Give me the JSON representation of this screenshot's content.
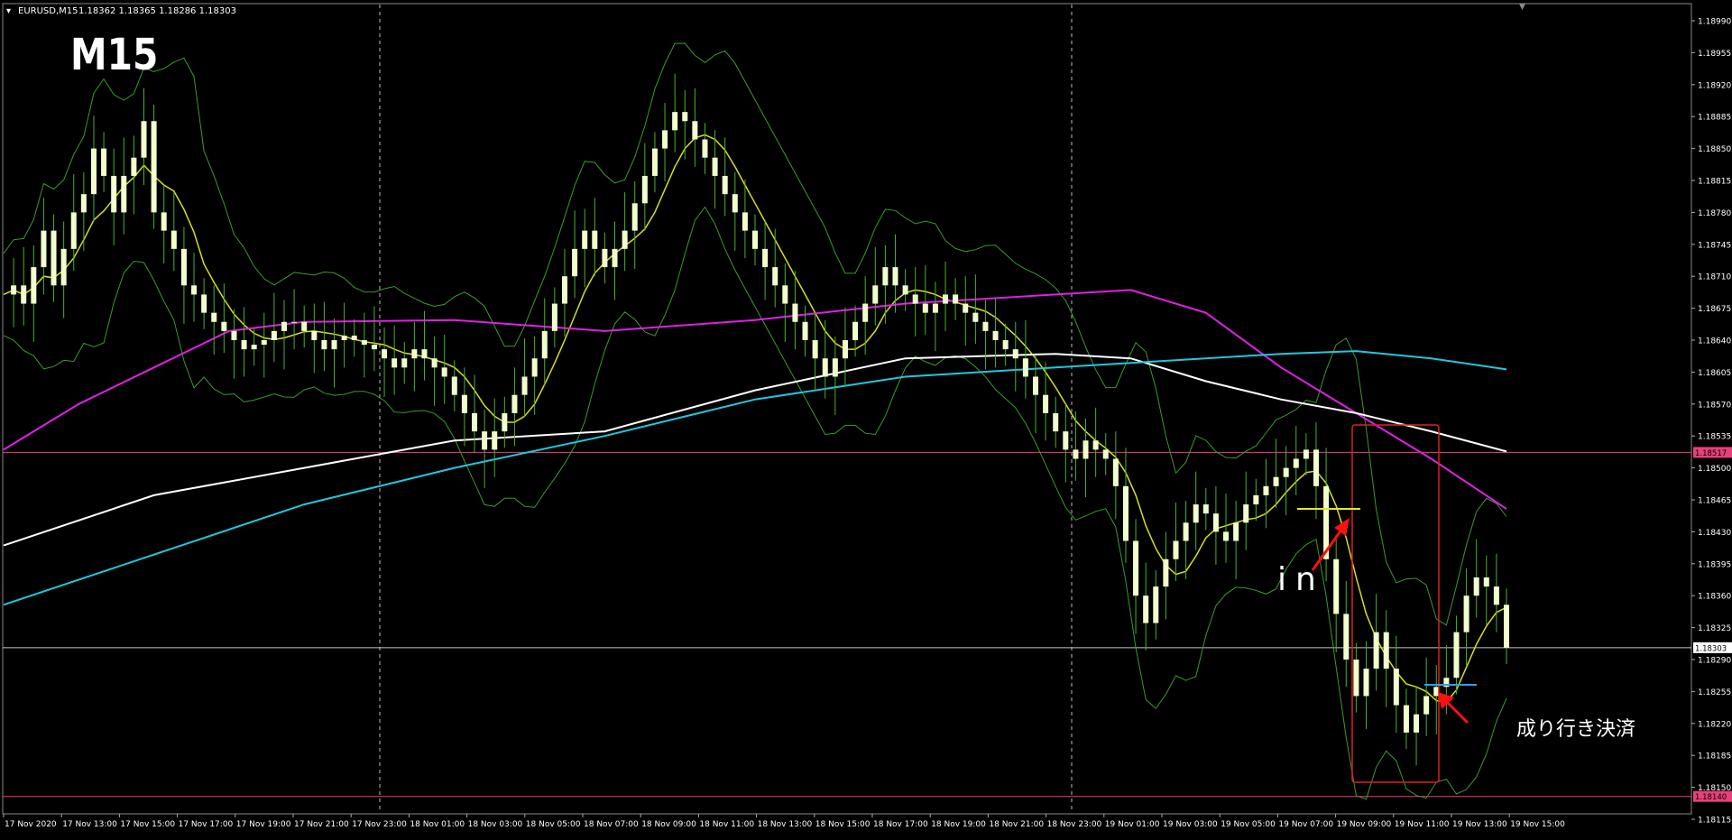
{
  "header": {
    "symbol_timeframe": "EURUSD,M15",
    "ohlc": "1.18362 1.18365 1.18286 1.18303"
  },
  "overlay": {
    "timeframe_label": "M15",
    "entry_label": "in",
    "exit_label": "成り行き決済"
  },
  "price_axis": {
    "ticks": [
      "1.18990",
      "1.18955",
      "1.18920",
      "1.18885",
      "1.18850",
      "1.18815",
      "1.18780",
      "1.18745",
      "1.18710",
      "1.18675",
      "1.18640",
      "1.18605",
      "1.18570",
      "1.18535",
      "1.18500",
      "1.18465",
      "1.18430",
      "1.18395",
      "1.18360",
      "1.18325",
      "1.18290",
      "1.18255",
      "1.18220",
      "1.18185",
      "1.18150",
      "1.18115"
    ],
    "level_high_label": "1.18517",
    "level_current_label": "1.18303",
    "level_low_label": "1.18140"
  },
  "time_axis": {
    "labels": [
      "17 Nov 2020",
      "17 Nov 13:00",
      "17 Nov 15:00",
      "17 Nov 17:00",
      "17 Nov 19:00",
      "17 Nov 21:00",
      "17 Nov 23:00",
      "18 Nov 01:00",
      "18 Nov 03:00",
      "18 Nov 05:00",
      "18 Nov 07:00",
      "18 Nov 09:00",
      "18 Nov 11:00",
      "18 Nov 13:00",
      "18 Nov 15:00",
      "18 Nov 17:00",
      "18 Nov 19:00",
      "18 Nov 21:00",
      "18 Nov 23:00",
      "19 Nov 01:00",
      "19 Nov 03:00",
      "19 Nov 05:00",
      "19 Nov 07:00",
      "19 Nov 09:00",
      "19 Nov 11:00",
      "19 Nov 13:00",
      "19 Nov 15:00"
    ]
  },
  "colors": {
    "background": "#000000",
    "candle": "#f2ffcc",
    "wick": "#4caf2c",
    "sma_fast": "#d6e01a",
    "ma_magenta": "#e21ee8",
    "ma_white": "#ffffff",
    "ma_cyan": "#1ec8e0",
    "bollinger": "#3a9a30",
    "level_magenta": "#e8407a",
    "level_current": "#c8c8c8",
    "box": "#e02020",
    "arrow": "#ff1010",
    "entry_line": "#e8e820",
    "exit_line": "#30a0e8"
  },
  "chart_data": {
    "type": "candlestick",
    "symbol": "EURUSD",
    "timeframe": "M15",
    "ylim": [
      1.18115,
      1.19005
    ],
    "x_start": "17 Nov 2020 11:00",
    "x_end": "19 Nov 2020 15:15",
    "last_ohlc": {
      "open": 1.18362,
      "high": 1.18365,
      "low": 1.18286,
      "close": 1.18303
    },
    "horizontal_levels": [
      1.18517,
      1.18303,
      1.1814
    ],
    "close_series": [
      1.1869,
      1.187,
      1.1868,
      1.1872,
      1.1876,
      1.187,
      1.1874,
      1.1878,
      1.188,
      1.1885,
      1.1882,
      1.1878,
      1.1882,
      1.1884,
      1.1888,
      1.1878,
      1.1876,
      1.1874,
      1.187,
      1.1869,
      1.1867,
      1.1866,
      1.1865,
      1.1864,
      1.1863,
      1.18635,
      1.1864,
      1.1865,
      1.1866,
      1.1866,
      1.1865,
      1.1864,
      1.1863,
      1.1864,
      1.18645,
      1.1864,
      1.18635,
      1.1863,
      1.1862,
      1.1861,
      1.1862,
      1.1863,
      1.1862,
      1.1861,
      1.186,
      1.1858,
      1.1856,
      1.1854,
      1.1852,
      1.1854,
      1.1856,
      1.1858,
      1.186,
      1.1862,
      1.1865,
      1.1868,
      1.1871,
      1.1874,
      1.1876,
      1.1874,
      1.1872,
      1.1874,
      1.1876,
      1.1879,
      1.1882,
      1.1885,
      1.1887,
      1.1889,
      1.1888,
      1.1886,
      1.1884,
      1.1882,
      1.188,
      1.1878,
      1.1876,
      1.1874,
      1.1872,
      1.187,
      1.1868,
      1.1866,
      1.1864,
      1.1862,
      1.186,
      1.1862,
      1.1864,
      1.1866,
      1.1868,
      1.187,
      1.1872,
      1.187,
      1.1869,
      1.1868,
      1.1867,
      1.1868,
      1.1869,
      1.1868,
      1.1867,
      1.1866,
      1.1865,
      1.1864,
      1.1863,
      1.1862,
      1.186,
      1.1858,
      1.1856,
      1.1854,
      1.1852,
      1.1851,
      1.1853,
      1.1852,
      1.1851,
      1.1848,
      1.1842,
      1.1836,
      1.1833,
      1.1837,
      1.184,
      1.1842,
      1.1844,
      1.1846,
      1.1845,
      1.1843,
      1.1842,
      1.1844,
      1.1846,
      1.1847,
      1.1848,
      1.1849,
      1.185,
      1.1851,
      1.1852,
      1.1848,
      1.184,
      1.1834,
      1.1829,
      1.1825,
      1.1828,
      1.1832,
      1.1828,
      1.1824,
      1.1821,
      1.1823,
      1.1825,
      1.1826,
      1.1827,
      1.1832,
      1.1836,
      1.1838,
      1.1837,
      1.1835,
      1.18303
    ],
    "close_series_interval": "15 min (sampled every 1 bar-group)",
    "indicators": [
      "Bollinger Bands",
      "Moving Average (yellow)",
      "Moving Average (magenta)",
      "Moving Average (white)",
      "Moving Average (cyan)"
    ],
    "annotations": [
      {
        "text": "in",
        "price": 1.1845,
        "time": "19 Nov 09:15"
      },
      {
        "text": "成り行き決済",
        "price": 1.18255,
        "time": "19 Nov 11:30"
      }
    ],
    "grid": false
  }
}
